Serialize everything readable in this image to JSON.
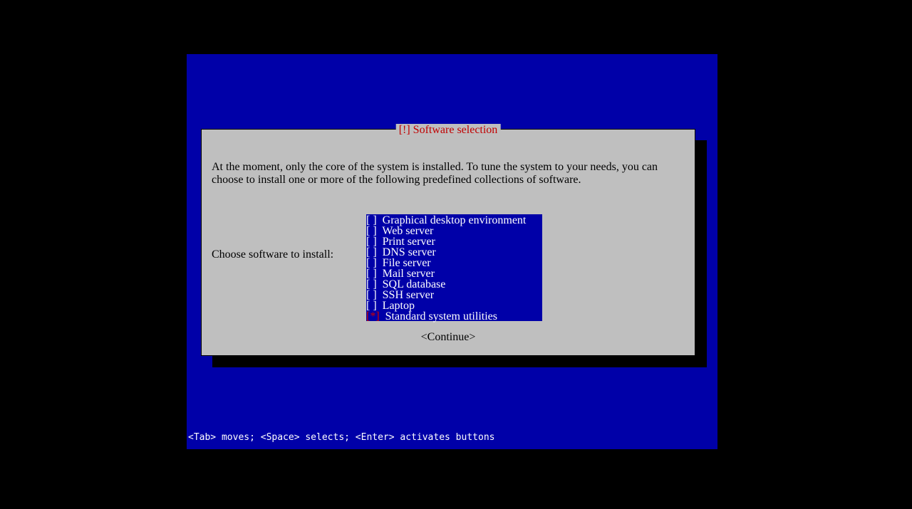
{
  "title_lead": " [!] ",
  "title_text": "Software selection",
  "title_trail": " ",
  "para": "At the moment, only the core of the system is installed. To tune the system to your needs, you can choose to install one or more of the following predefined collections of software.",
  "prompt": "Choose software to install:",
  "items": [
    {
      "checked": false,
      "label": "Graphical desktop environment",
      "focused": false
    },
    {
      "checked": false,
      "label": "Web server",
      "focused": false
    },
    {
      "checked": false,
      "label": "Print server",
      "focused": false
    },
    {
      "checked": false,
      "label": "DNS server",
      "focused": false
    },
    {
      "checked": false,
      "label": "File server",
      "focused": false
    },
    {
      "checked": false,
      "label": "Mail server",
      "focused": false
    },
    {
      "checked": false,
      "label": "SQL database",
      "focused": false
    },
    {
      "checked": false,
      "label": "SSH server",
      "focused": false
    },
    {
      "checked": false,
      "label": "Laptop",
      "focused": false
    },
    {
      "checked": true,
      "label": "Standard system utilities",
      "focused": true
    }
  ],
  "continue": "<Continue>",
  "help": "<Tab> moves; <Space> selects; <Enter> activates buttons"
}
